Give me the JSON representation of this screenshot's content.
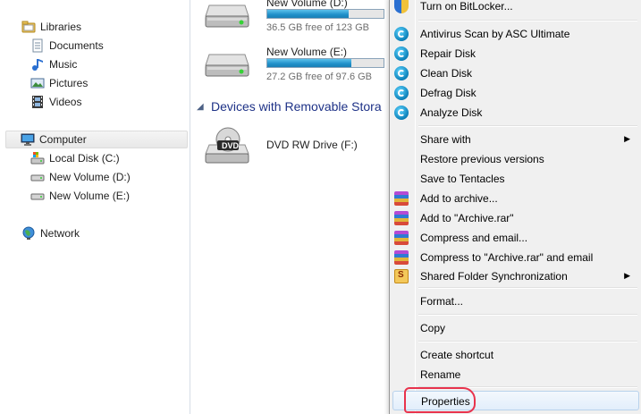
{
  "nav": {
    "libraries": "Libraries",
    "documents": "Documents",
    "music": "Music",
    "pictures": "Pictures",
    "videos": "Videos",
    "computer": "Computer",
    "local_disk": "Local Disk (C:)",
    "volume_d": "New Volume (D:)",
    "volume_e": "New Volume (E:)",
    "network": "Network"
  },
  "content": {
    "drives": [
      {
        "name": "New Volume (D:)",
        "free": "36.5 GB free of 123 GB",
        "used_fraction": 0.7
      },
      {
        "name": "New Volume (E:)",
        "free": "27.2 GB free of 97.6 GB",
        "used_fraction": 0.72
      }
    ],
    "removable_header": "Devices with Removable Stora",
    "dvd": {
      "name": "DVD RW Drive (F:)",
      "icon_label": "DVD"
    }
  },
  "menu": {
    "bitlocker": "Turn on BitLocker...",
    "antivirus": "Antivirus Scan by ASC Ultimate",
    "repair": "Repair Disk",
    "clean": "Clean Disk",
    "defrag": "Defrag Disk",
    "analyze": "Analyze Disk",
    "share": "Share with",
    "restore": "Restore previous versions",
    "tentacles": "Save to Tentacles",
    "add_archive": "Add to archive...",
    "add_rar": "Add to \"Archive.rar\"",
    "compress_email": "Compress and email...",
    "compress_rar_email": "Compress to \"Archive.rar\" and email",
    "shared_sync": "Shared Folder Synchronization",
    "format": "Format...",
    "copy": "Copy",
    "create_shortcut": "Create shortcut",
    "rename": "Rename",
    "properties": "Properties"
  },
  "colors": {
    "accent_header": "#1e3287",
    "highlight_circle": "#e8334d",
    "bar_fill": "#1f8fc9"
  },
  "icons": {
    "libraries": "libraries-icon",
    "documents": "document-icon",
    "music": "music-note-icon",
    "pictures": "picture-icon",
    "videos": "film-icon",
    "computer": "computer-icon",
    "drives": "hard-drive-icon",
    "network": "network-globe-icon",
    "asc": "asc-ultimate-icon",
    "winrar": "winrar-icon",
    "bitlocker": "uac-shield-icon"
  }
}
